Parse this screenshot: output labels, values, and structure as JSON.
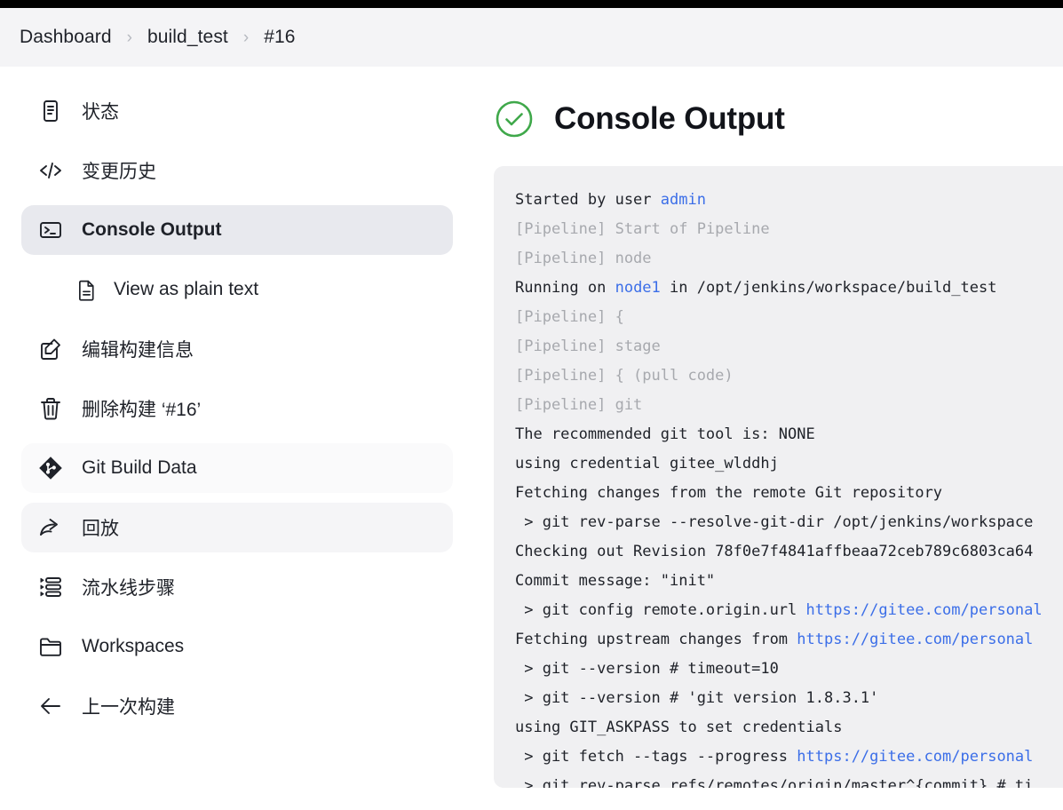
{
  "breadcrumb": {
    "items": [
      {
        "label": "Dashboard",
        "name": "breadcrumb-dashboard"
      },
      {
        "label": "build_test",
        "name": "breadcrumb-build-test"
      },
      {
        "label": "#16",
        "name": "breadcrumb-build-number"
      }
    ],
    "separator": "›"
  },
  "sidebar": {
    "items": [
      {
        "label": "状态",
        "icon": "document-icon",
        "name": "sidebar-item-status",
        "selected": false,
        "sub": false,
        "tint": ""
      },
      {
        "label": "变更历史",
        "icon": "code-icon",
        "name": "sidebar-item-changes",
        "selected": false,
        "sub": false,
        "tint": ""
      },
      {
        "label": "Console Output",
        "icon": "terminal-icon",
        "name": "sidebar-item-console-output",
        "selected": true,
        "sub": false,
        "tint": ""
      },
      {
        "label": "View as plain text",
        "icon": "plain-text-icon",
        "name": "sidebar-item-view-plain-text",
        "selected": false,
        "sub": true,
        "tint": ""
      },
      {
        "label": "编辑构建信息",
        "icon": "edit-icon",
        "name": "sidebar-item-edit-build-information",
        "selected": false,
        "sub": false,
        "tint": ""
      },
      {
        "label": "删除构建 ‘#16’",
        "icon": "trash-icon",
        "name": "sidebar-item-delete-build",
        "selected": false,
        "sub": false,
        "tint": ""
      },
      {
        "label": "Git Build Data",
        "icon": "git-icon",
        "name": "sidebar-item-git-build-data",
        "selected": false,
        "sub": false,
        "tint": "tint-a"
      },
      {
        "label": "回放",
        "icon": "replay-icon",
        "name": "sidebar-item-replay",
        "selected": false,
        "sub": false,
        "tint": "tint-b"
      },
      {
        "label": "流水线步骤",
        "icon": "pipeline-steps-icon",
        "name": "sidebar-item-pipeline-steps",
        "selected": false,
        "sub": false,
        "tint": ""
      },
      {
        "label": "Workspaces",
        "icon": "folder-icon",
        "name": "sidebar-item-workspaces",
        "selected": false,
        "sub": false,
        "tint": ""
      },
      {
        "label": "上一次构建",
        "icon": "arrow-left-icon",
        "name": "sidebar-item-previous-build",
        "selected": false,
        "sub": false,
        "tint": ""
      }
    ]
  },
  "main": {
    "title": "Console Output",
    "status_icon": "success-check-icon",
    "status_color": "#3fa84a",
    "console": {
      "lines": [
        {
          "segs": [
            {
              "t": "Started by user ",
              "k": "n"
            },
            {
              "t": "admin",
              "k": "l"
            }
          ]
        },
        {
          "segs": [
            {
              "t": "[Pipeline] Start of Pipeline",
              "k": "d"
            }
          ]
        },
        {
          "segs": [
            {
              "t": "[Pipeline] node",
              "k": "d"
            }
          ]
        },
        {
          "segs": [
            {
              "t": "Running on ",
              "k": "n"
            },
            {
              "t": "node1",
              "k": "l"
            },
            {
              "t": " in /opt/jenkins/workspace/build_test",
              "k": "n"
            }
          ]
        },
        {
          "segs": [
            {
              "t": "[Pipeline] {",
              "k": "d"
            }
          ]
        },
        {
          "segs": [
            {
              "t": "[Pipeline] stage",
              "k": "d"
            }
          ]
        },
        {
          "segs": [
            {
              "t": "[Pipeline] { (pull code)",
              "k": "d"
            }
          ]
        },
        {
          "segs": [
            {
              "t": "[Pipeline] git",
              "k": "d"
            }
          ]
        },
        {
          "segs": [
            {
              "t": "The recommended git tool is: NONE",
              "k": "n"
            }
          ]
        },
        {
          "segs": [
            {
              "t": "using credential gitee_wlddhj",
              "k": "n"
            }
          ]
        },
        {
          "segs": [
            {
              "t": "Fetching changes from the remote Git repository",
              "k": "n"
            }
          ]
        },
        {
          "segs": [
            {
              "t": " > git rev-parse --resolve-git-dir /opt/jenkins/workspace",
              "k": "n"
            }
          ]
        },
        {
          "segs": [
            {
              "t": "Checking out Revision 78f0e7f4841affbeaa72ceb789c6803ca64",
              "k": "n"
            }
          ]
        },
        {
          "segs": [
            {
              "t": "Commit message: \"init\"",
              "k": "n"
            }
          ]
        },
        {
          "segs": [
            {
              "t": " > git config remote.origin.url ",
              "k": "n"
            },
            {
              "t": "https://gitee.com/personal",
              "k": "l"
            }
          ]
        },
        {
          "segs": [
            {
              "t": "Fetching upstream changes from ",
              "k": "n"
            },
            {
              "t": "https://gitee.com/personal",
              "k": "l"
            }
          ]
        },
        {
          "segs": [
            {
              "t": " > git --version # timeout=10",
              "k": "n"
            }
          ]
        },
        {
          "segs": [
            {
              "t": " > git --version # 'git version 1.8.3.1'",
              "k": "n"
            }
          ]
        },
        {
          "segs": [
            {
              "t": "using GIT_ASKPASS to set credentials",
              "k": "n"
            }
          ]
        },
        {
          "segs": [
            {
              "t": " > git fetch --tags --progress ",
              "k": "n"
            },
            {
              "t": "https://gitee.com/personal",
              "k": "l"
            }
          ]
        },
        {
          "segs": [
            {
              "t": " > git rev-parse refs/remotes/origin/master^{commit} # ti",
              "k": "n"
            }
          ]
        }
      ]
    }
  }
}
